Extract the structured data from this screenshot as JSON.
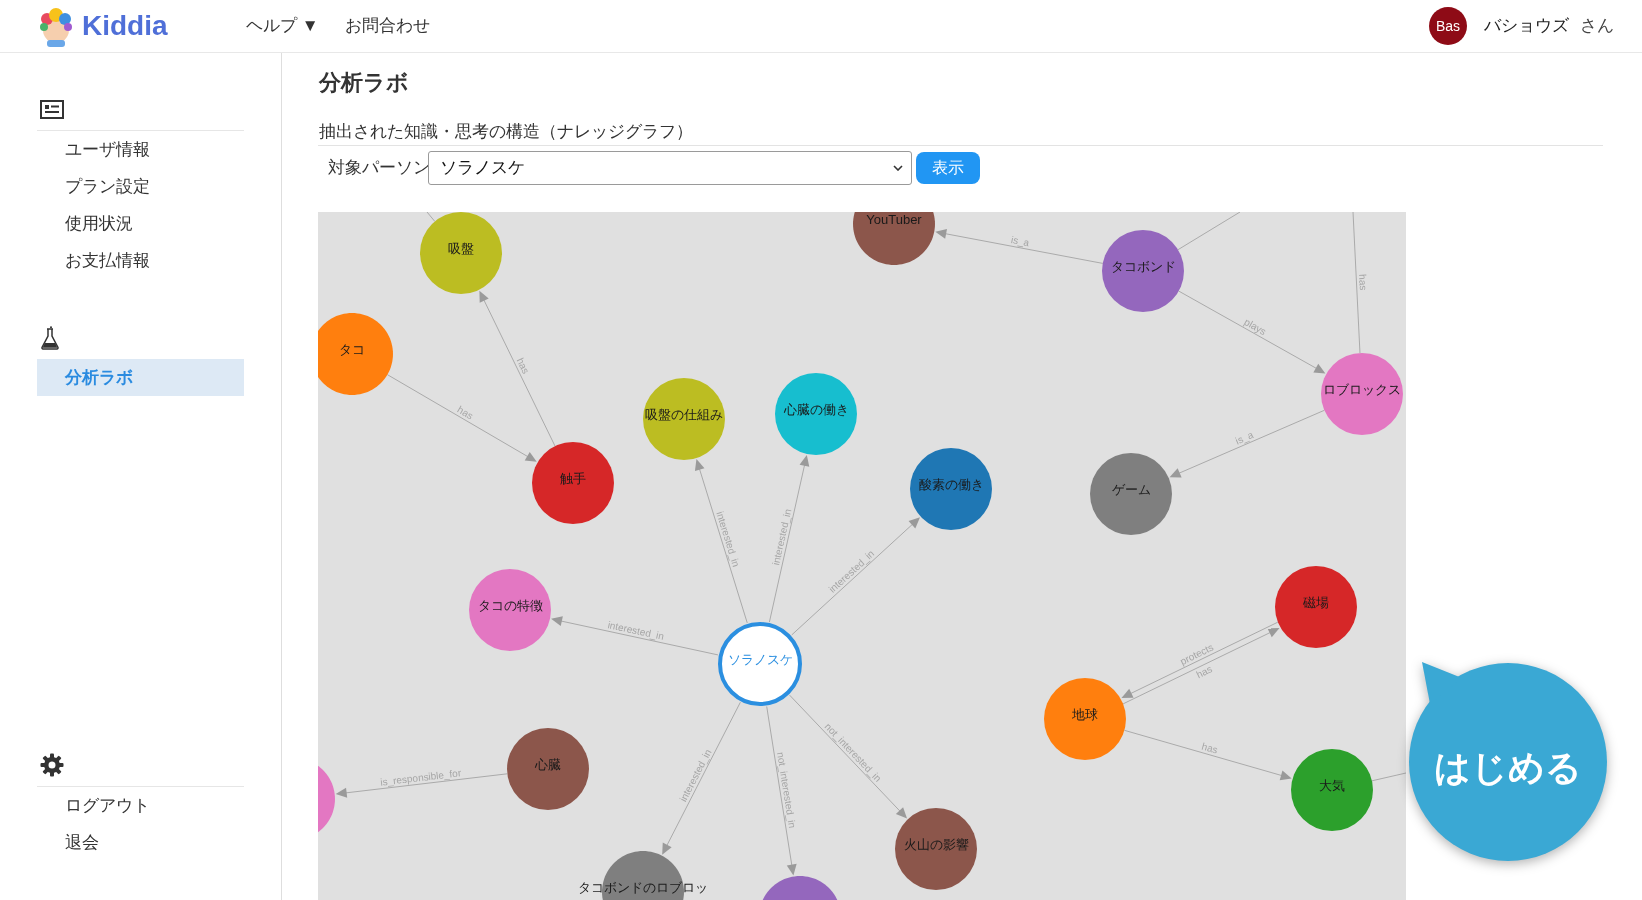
{
  "header": {
    "logo": "Kiddia",
    "nav": [
      "ヘルプ ▼",
      "お問合わせ"
    ],
    "user": {
      "initials": "Bas",
      "name": "バショウズ",
      "honorific": "さん"
    }
  },
  "sidebar": {
    "sections": [
      {
        "items": [
          {
            "label": "ユーザ情報",
            "selected": false
          },
          {
            "label": "プラン設定",
            "selected": false
          },
          {
            "label": "使用状況",
            "selected": false
          },
          {
            "label": "お支払情報",
            "selected": false
          }
        ]
      },
      {
        "items": [
          {
            "label": "分析ラボ",
            "selected": true
          }
        ]
      },
      {
        "items": [
          {
            "label": "ログアウト",
            "selected": false
          },
          {
            "label": "退会",
            "selected": false
          }
        ]
      }
    ]
  },
  "main": {
    "title": "分析ラボ",
    "subtitle": "抽出された知識・思考の構造（ナレッジグラフ）",
    "person_select": {
      "label": "対象パーソン",
      "value": "ソラノスケ"
    },
    "show_button": "表示",
    "graph": {
      "nodes": [
        {
          "label": "吸盤",
          "kind": "topic",
          "color": "#bcbd22"
        },
        {
          "label": "YouTuber",
          "kind": "topic",
          "color": "#8c564b"
        },
        {
          "label": "タコボンド",
          "kind": "topic",
          "color": "#9467bd"
        },
        {
          "label": "タコ",
          "kind": "topic",
          "color": "#ff7f0e"
        },
        {
          "label": "ロブロックス",
          "kind": "topic",
          "color": "#e377c2"
        },
        {
          "label": "吸盤の仕組み",
          "kind": "topic",
          "color": "#bcbd22"
        },
        {
          "label": "心臓の働き",
          "kind": "topic",
          "color": "#17becf"
        },
        {
          "label": "触手",
          "kind": "topic",
          "color": "#d62728"
        },
        {
          "label": "酸素の働き",
          "kind": "topic",
          "color": "#1f77b4"
        },
        {
          "label": "ゲーム",
          "kind": "topic",
          "color": "#7f7f7f"
        },
        {
          "label": "磁場",
          "kind": "topic",
          "color": "#d62728"
        },
        {
          "label": "タコの特徴",
          "kind": "topic",
          "color": "#e377c2"
        },
        {
          "label": "ソラノスケ",
          "kind": "person"
        },
        {
          "label": "地球",
          "kind": "topic",
          "color": "#ff7f0e"
        },
        {
          "label": "心臓",
          "kind": "topic",
          "color": "#8c564b"
        },
        {
          "label": "大気",
          "kind": "topic",
          "color": "#2ca02c"
        },
        {
          "kind": "topic",
          "color": "#e377c2"
        },
        {
          "label": "火山の影響",
          "kind": "topic",
          "color": "#8c564b"
        },
        {
          "label": "タコボンドのロブロッ",
          "kind": "topic",
          "color": "#7f7f7f"
        },
        {
          "kind": "topic",
          "color": "#9467bd"
        }
      ],
      "edges": [
        {
          "kind": "arrow",
          "label": "has"
        },
        {
          "kind": "arrow",
          "label": "has"
        },
        {
          "kind": "arrow",
          "label": "is_a"
        },
        {
          "kind": "arrow",
          "label": "plays"
        },
        {
          "kind": "stub",
          "label": "has"
        },
        {
          "kind": "arrow",
          "label": "is_a"
        },
        {
          "kind": "arrow",
          "label": "interested_in"
        },
        {
          "kind": "arrow",
          "label": "interested_in"
        },
        {
          "kind": "arrow",
          "label": "interested_in"
        },
        {
          "kind": "arrow",
          "label": "interested_in"
        },
        {
          "kind": "arrow",
          "label": "protects"
        },
        {
          "kind": "arrow",
          "label": "has"
        },
        {
          "kind": "arrow",
          "label": "has"
        },
        {
          "kind": "arrow",
          "label": "is_responsible_for"
        },
        {
          "kind": "arrow",
          "label": "interested_in"
        },
        {
          "kind": "arrow",
          "label": "not_interested_in"
        },
        {
          "kind": "arrow",
          "label": "not_interested_in"
        },
        {
          "kind": "stub"
        },
        {
          "kind": "stub"
        },
        {
          "kind": "stub"
        }
      ]
    }
  },
  "start_button": "はじめる"
}
